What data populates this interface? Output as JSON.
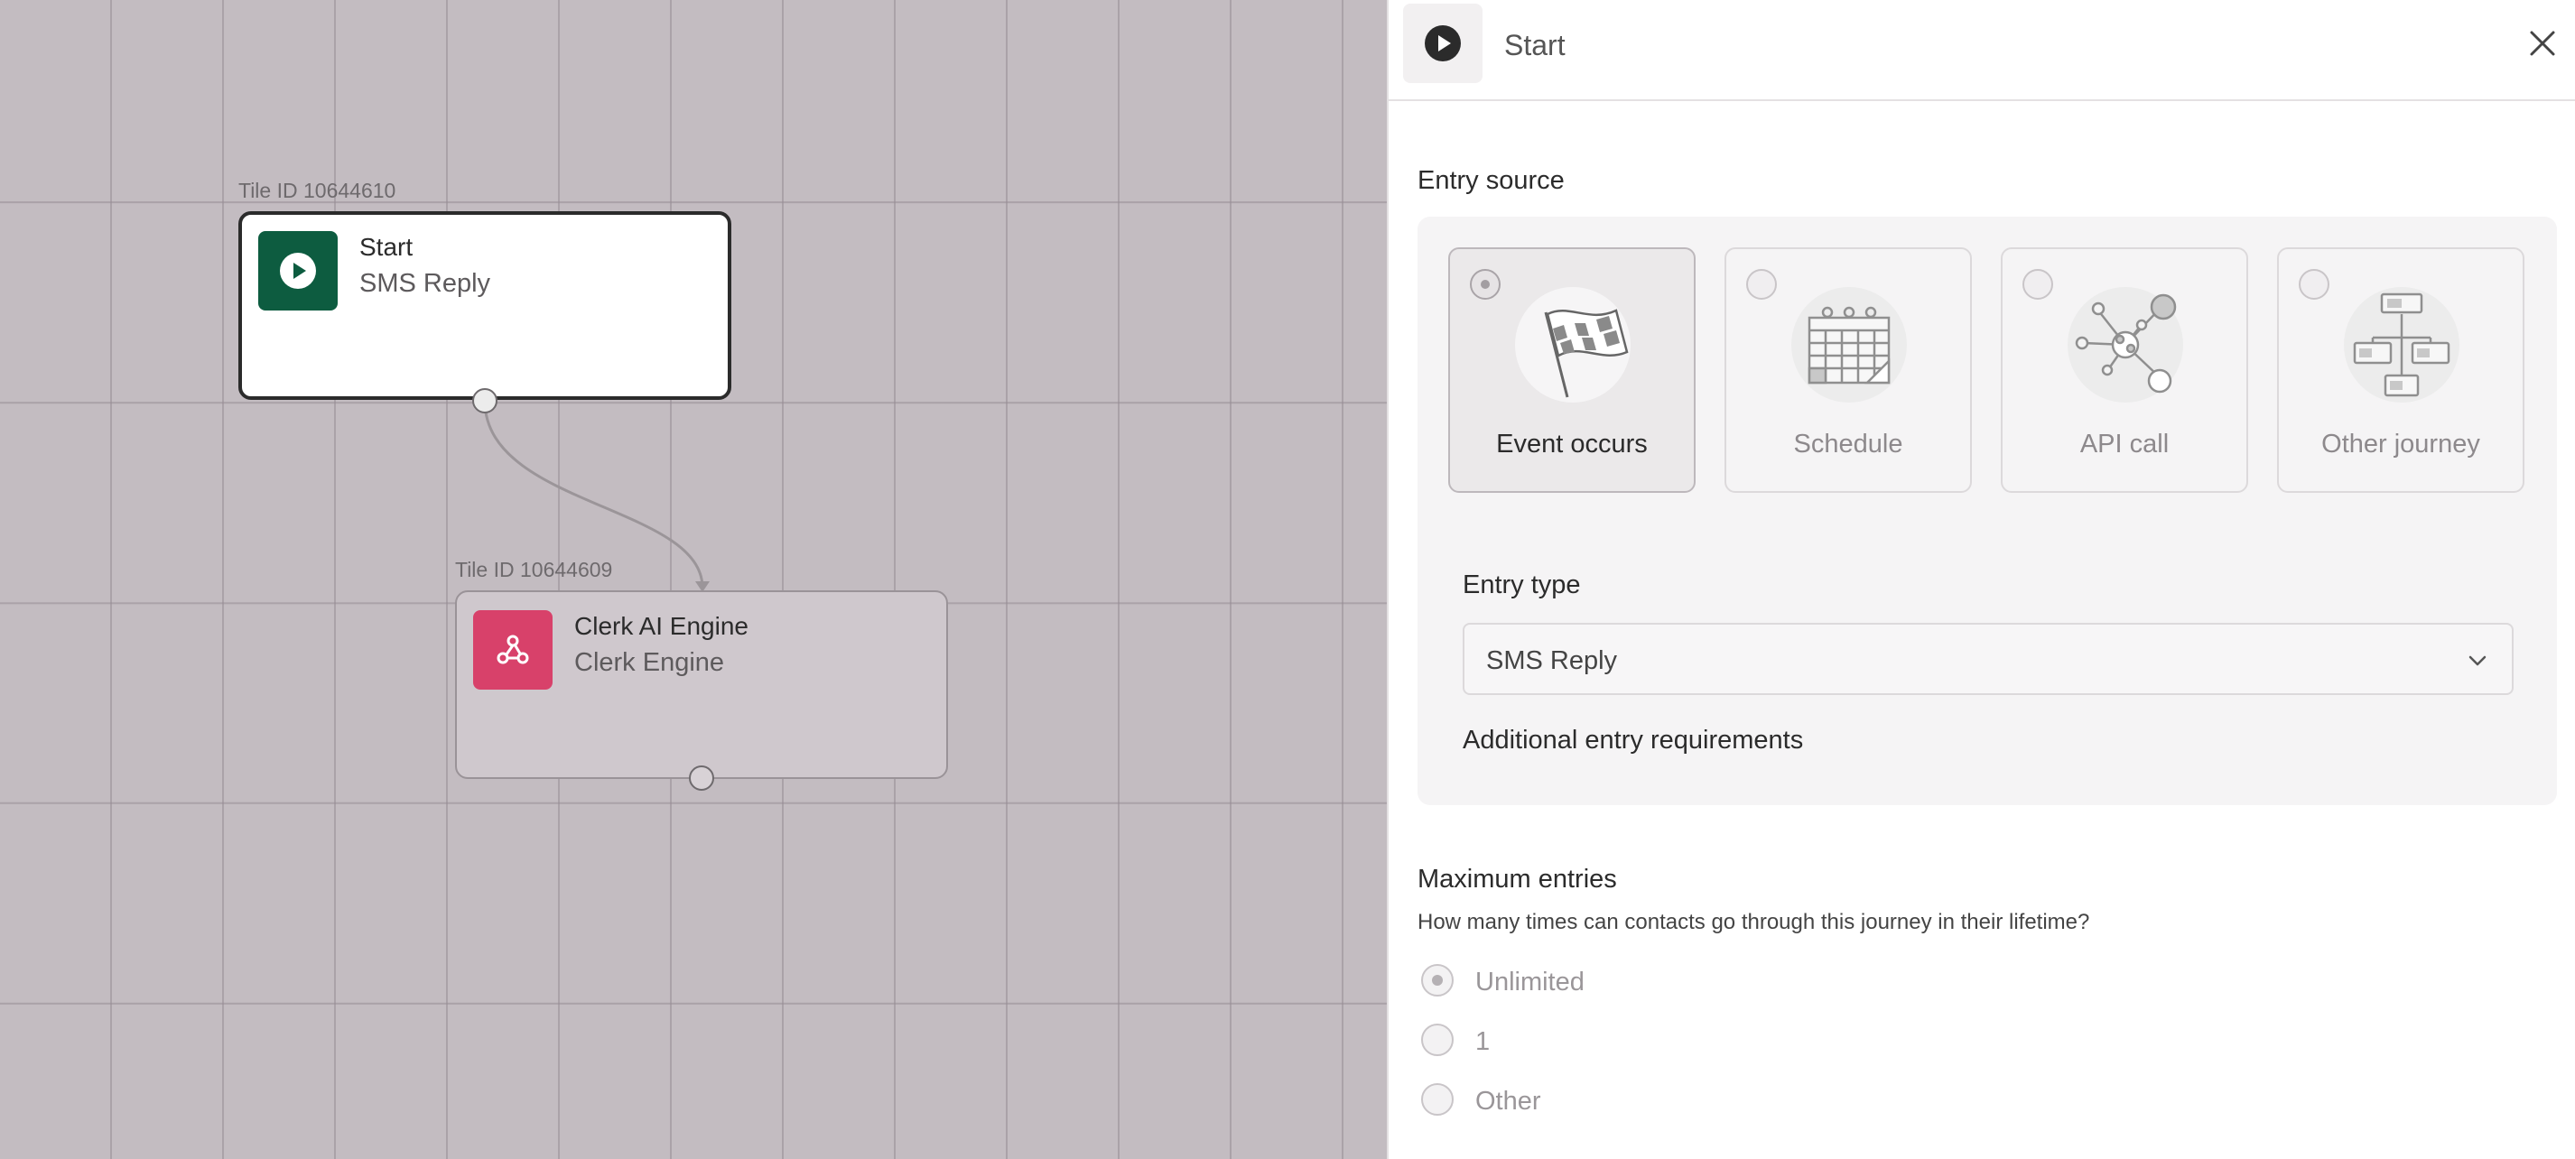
{
  "canvas": {
    "tiles": [
      {
        "tile_id": "Tile ID 10644610",
        "title": "Start",
        "subtitle": "SMS Reply",
        "icon": "play-icon",
        "color": "#0d5c40"
      },
      {
        "tile_id": "Tile ID 10644609",
        "title": "Clerk AI Engine",
        "subtitle": "Clerk Engine",
        "icon": "webhook-icon",
        "color": "#d8416a"
      }
    ]
  },
  "panel": {
    "title": "Start",
    "header_icon": "play-icon",
    "close_icon": "close-icon",
    "entry_source": {
      "label": "Entry source",
      "options": [
        {
          "label": "Event occurs",
          "selected": true,
          "icon": "checkered-flag-icon"
        },
        {
          "label": "Schedule",
          "selected": false,
          "icon": "calendar-icon"
        },
        {
          "label": "API call",
          "selected": false,
          "icon": "network-nodes-icon"
        },
        {
          "label": "Other journey",
          "selected": false,
          "icon": "flowchart-icon"
        }
      ]
    },
    "entry_type": {
      "label": "Entry type",
      "value": "SMS Reply"
    },
    "additional_requirements": "Additional entry requirements",
    "maximum_entries": {
      "title": "Maximum entries",
      "description": "How many times can contacts go through this journey in their lifetime?",
      "options": [
        {
          "label": "Unlimited",
          "selected": true
        },
        {
          "label": "1",
          "selected": false
        },
        {
          "label": "Other",
          "selected": false
        }
      ]
    }
  }
}
